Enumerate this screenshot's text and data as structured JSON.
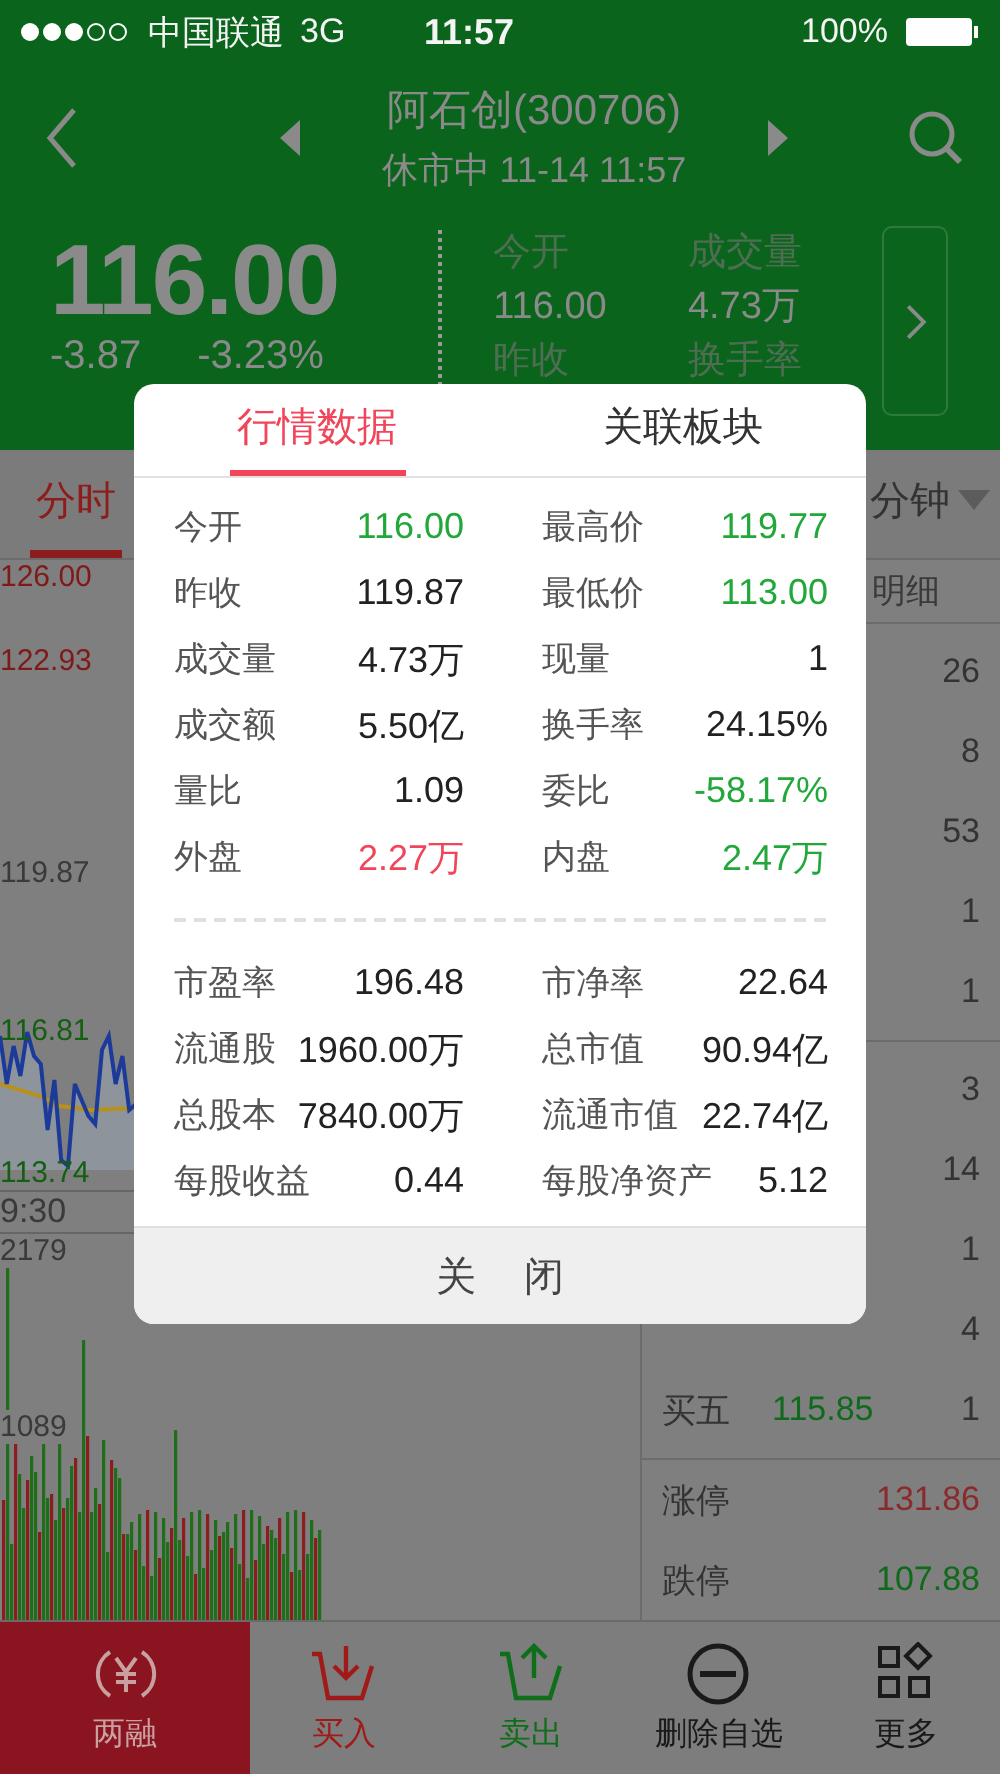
{
  "status_bar": {
    "carrier": "中国联通",
    "network": "3G",
    "time": "11:57",
    "battery": "100%"
  },
  "header": {
    "title": "阿石创(300706)",
    "subtitle": "休市中 11-14 11:57"
  },
  "quote": {
    "price": "116.00",
    "change": "-3.87",
    "change_pct": "-3.23%",
    "stats": [
      {
        "label": "今开",
        "value": "116.00",
        "next_label": "昨收"
      },
      {
        "label": "成交量",
        "value": "4.73万",
        "next_label": "换手率"
      }
    ]
  },
  "chart_tabs": [
    {
      "label": "分时",
      "selected": true,
      "kind": "plain"
    },
    {
      "label": "分钟",
      "selected": false,
      "kind": "dropdown"
    }
  ],
  "price_axis": [
    {
      "label": "126.00",
      "color": "#7e1a1a"
    },
    {
      "label": "122.93",
      "color": "#7e1a1a"
    },
    {
      "label": "119.87",
      "color": "#3a3a3a"
    },
    {
      "label": "116.81",
      "color": "#145f14"
    },
    {
      "label": "113.74",
      "color": "#145f14"
    }
  ],
  "time_label": "9:30",
  "volume_axis": [
    "2179",
    "1089"
  ],
  "order_book": {
    "header": "明细",
    "groups": [
      [
        {
          "volume": "26"
        },
        {
          "volume": "8"
        },
        {
          "volume": "53"
        },
        {
          "volume": "1"
        },
        {
          "volume": "1"
        }
      ],
      [
        {
          "volume": "3"
        },
        {
          "volume": "14"
        },
        {
          "volume": "1"
        },
        {
          "volume": "4"
        },
        {
          "label": "买五",
          "price": "115.85",
          "volume": "1"
        }
      ]
    ],
    "limits": [
      {
        "label": "涨停",
        "value": "131.86",
        "color": "#8a2a2a"
      },
      {
        "label": "跌停",
        "value": "107.88",
        "color": "#0f6a1c"
      }
    ]
  },
  "bottom_nav": [
    {
      "label": "两融",
      "kind": "margin",
      "selected": true,
      "color": "#c8a0a0"
    },
    {
      "label": "买入",
      "kind": "buy",
      "selected": false,
      "color": "#a01a1a"
    },
    {
      "label": "卖出",
      "kind": "sell",
      "selected": false,
      "color": "#0f6e1a"
    },
    {
      "label": "删除自选",
      "kind": "remove",
      "selected": false,
      "color": "#1a1a1a"
    },
    {
      "label": "更多",
      "kind": "more",
      "selected": false,
      "color": "#1a1a1a"
    }
  ],
  "dialog": {
    "tabs": [
      {
        "label": "行情数据",
        "selected": true
      },
      {
        "label": "关联板块",
        "selected": false
      }
    ],
    "sections": [
      [
        {
          "label": "今开",
          "value": "116.00",
          "color": "#22a83a"
        },
        {
          "label": "最高价",
          "value": "119.77",
          "color": "#22a83a"
        },
        {
          "label": "昨收",
          "value": "119.87",
          "color": "#222222"
        },
        {
          "label": "最低价",
          "value": "113.00",
          "color": "#22a83a"
        },
        {
          "label": "成交量",
          "value": "4.73万",
          "color": "#222222"
        },
        {
          "label": "现量",
          "value": "1",
          "color": "#222222"
        },
        {
          "label": "成交额",
          "value": "5.50亿",
          "color": "#222222"
        },
        {
          "label": "换手率",
          "value": "24.15%",
          "color": "#222222"
        },
        {
          "label": "量比",
          "value": "1.09",
          "color": "#222222"
        },
        {
          "label": "委比",
          "value": "-58.17%",
          "color": "#22a83a"
        },
        {
          "label": "外盘",
          "value": "2.27万",
          "color": "#f0455a"
        },
        {
          "label": "内盘",
          "value": "2.47万",
          "color": "#22a83a"
        }
      ],
      [
        {
          "label": "市盈率",
          "value": "196.48",
          "color": "#222222"
        },
        {
          "label": "市净率",
          "value": "22.64",
          "color": "#222222"
        },
        {
          "label": "流通股",
          "value": "1960.00万",
          "color": "#222222"
        },
        {
          "label": "总市值",
          "value": "90.94亿",
          "color": "#222222"
        },
        {
          "label": "总股本",
          "value": "7840.00万",
          "color": "#222222"
        },
        {
          "label": "流通市值",
          "value": "22.74亿",
          "color": "#222222"
        },
        {
          "label": "每股收益",
          "value": "0.44",
          "color": "#222222"
        },
        {
          "label": "每股净资产",
          "value": "5.12",
          "color": "#222222"
        }
      ]
    ],
    "close_button": "关 闭"
  }
}
